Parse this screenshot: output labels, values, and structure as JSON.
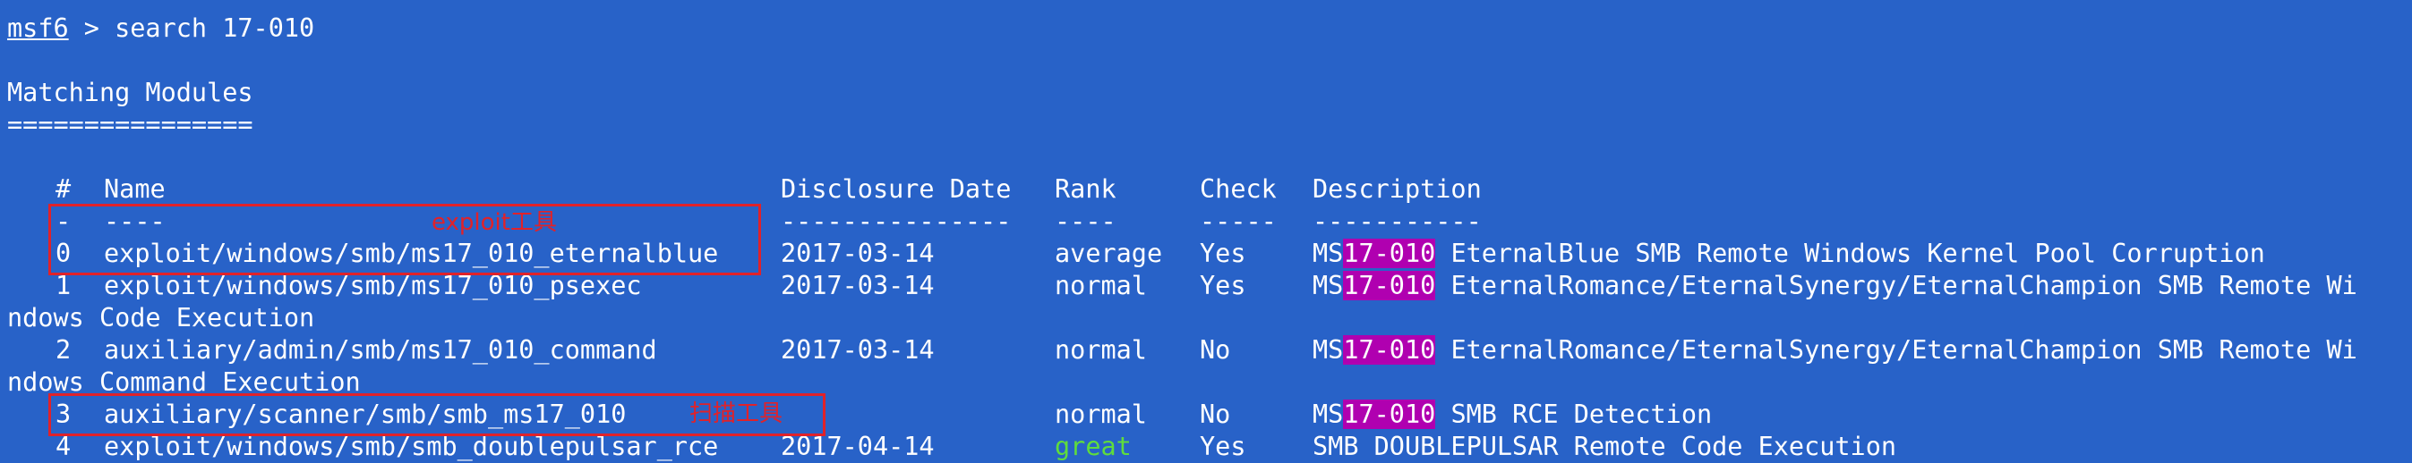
{
  "terminal": {
    "prompt": "msf6",
    "command": " > search 17-010",
    "heading": "Matching Modules",
    "heading_rule": "================",
    "columns": {
      "num": "#",
      "name": "Name",
      "date": "Disclosure Date",
      "rank": "Rank",
      "check": "Check",
      "desc": "Description"
    },
    "separators": {
      "num": "-",
      "name": "----",
      "date": "---------------",
      "rank": "----",
      "check": "-----",
      "desc": "-----------"
    },
    "rows": [
      {
        "num": "0",
        "name": "exploit/windows/smb/ms17_010_eternalblue",
        "date": "2017-03-14",
        "rank": "average",
        "check": "Yes",
        "desc_pre": "MS",
        "desc_hl": "17-010",
        "desc_post": " EternalBlue SMB Remote Windows Kernel Pool Corruption"
      },
      {
        "num": "1",
        "name": "exploit/windows/smb/ms17_010_psexec",
        "date": "2017-03-14",
        "rank": "normal",
        "check": "Yes",
        "desc_pre": "MS",
        "desc_hl": "17-010",
        "desc_post": " EternalRomance/EternalSynergy/EternalChampion SMB Remote Wi",
        "wrap": "ndows Code Execution"
      },
      {
        "num": "2",
        "name": "auxiliary/admin/smb/ms17_010_command",
        "date": "2017-03-14",
        "rank": "normal",
        "check": "No",
        "desc_pre": "MS",
        "desc_hl": "17-010",
        "desc_post": " EternalRomance/EternalSynergy/EternalChampion SMB Remote Wi",
        "wrap": "ndows Command Execution"
      },
      {
        "num": "3",
        "name": "auxiliary/scanner/smb/smb_ms17_010",
        "date": "",
        "rank": "normal",
        "check": "No",
        "desc_pre": "MS",
        "desc_hl": "17-010",
        "desc_post": " SMB RCE Detection"
      },
      {
        "num": "4",
        "name": "exploit/windows/smb/smb_doublepulsar_rce",
        "date": "2017-04-14",
        "rank": "great",
        "check": "Yes",
        "desc_pre": "SMB DOUBLEPULSAR Remote Code Execution",
        "desc_hl": "",
        "desc_post": ""
      }
    ]
  },
  "annotations": {
    "exploit_tool": "exploit工具",
    "scan_tool": "扫描工具",
    "color": "#e0222a"
  },
  "colors": {
    "background": "#2862c8",
    "text": "#ffffff",
    "highlight": "#b000b0",
    "great": "#5fdc3c"
  }
}
